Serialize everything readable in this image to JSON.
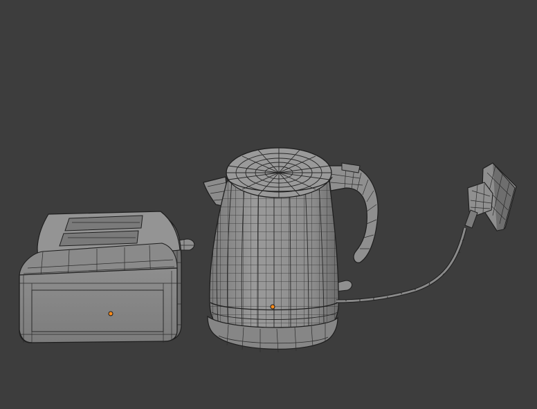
{
  "viewport": {
    "mode": "3d-viewport-wireframe-overlay",
    "background_color": "#3d3d3d",
    "mesh_color": "#8a8a8a",
    "origin_color": "#ff8c1a"
  },
  "objects": [
    {
      "name": "toaster",
      "origin_icon": "object-origin-icon"
    },
    {
      "name": "kettle",
      "origin_icon": "object-origin-icon"
    },
    {
      "name": "power-cord",
      "origin_icon": ""
    },
    {
      "name": "plug-socket",
      "origin_icon": ""
    }
  ]
}
